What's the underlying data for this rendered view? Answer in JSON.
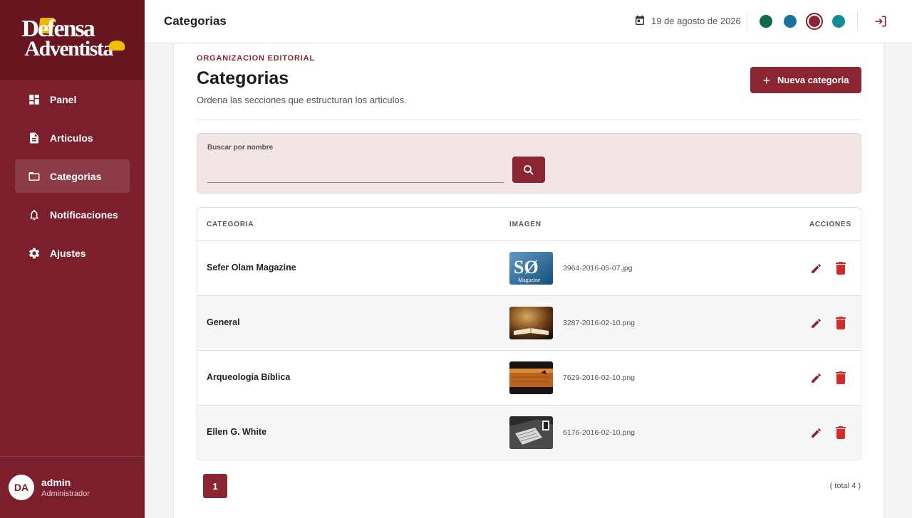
{
  "brand": {
    "line1": "Defensa",
    "line2": "Adventista"
  },
  "sidebar": {
    "items": [
      {
        "label": "Panel",
        "icon": "dashboard-icon"
      },
      {
        "label": "Articulos",
        "icon": "document-icon"
      },
      {
        "label": "Categorias",
        "icon": "folder-icon",
        "active": true
      },
      {
        "label": "Notificaciones",
        "icon": "bell-icon"
      },
      {
        "label": "Ajustes",
        "icon": "gear-icon"
      }
    ],
    "user": {
      "initials": "DA",
      "name": "admin",
      "role": "Administrador"
    }
  },
  "topbar": {
    "title": "Categorias",
    "date": "19 de agosto de 2026",
    "themes": [
      "#0e6b47",
      "#1674a3",
      "#8b2532",
      "#138c96"
    ],
    "selected_theme": 2
  },
  "header": {
    "eyebrow": "ORGANIZACION EDITORIAL",
    "title": "Categorias",
    "description": "Ordena las secciones que estructuran los articulos.",
    "new_button": "Nueva categoria"
  },
  "search": {
    "label": "Buscar por nombre",
    "value": ""
  },
  "table": {
    "headers": {
      "category": "CATEGORIA",
      "image": "IMAGEN",
      "actions": "ACCIONES"
    },
    "rows": [
      {
        "name": "Sefer Olam Magazine",
        "file": "3964-2016-05-07.jpg"
      },
      {
        "name": "General",
        "file": "3287-2016-02-10.png"
      },
      {
        "name": "Arqueología Bíblica",
        "file": "7629-2016-02-10.png"
      },
      {
        "name": "Ellen G. White",
        "file": "6176-2016-02-10.png"
      }
    ]
  },
  "pagination": {
    "current": "1",
    "total": "( total 4 )"
  },
  "colors": {
    "sidebar": "#7a1f2b",
    "accent": "#8b2532",
    "search_bg": "#f3e5e5"
  }
}
